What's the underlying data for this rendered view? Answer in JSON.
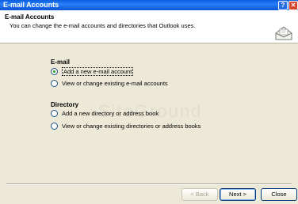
{
  "window": {
    "title": "E-mail Accounts",
    "help_label": "?",
    "close_label": "✕"
  },
  "header": {
    "title": "E-mail Accounts",
    "description": "You can change the e-mail accounts and directories that Outlook uses."
  },
  "watermark": "SiteGround",
  "email_section": {
    "title": "E-mail",
    "options": [
      {
        "label": "Add a new e-mail account",
        "selected": true
      },
      {
        "label": "View or change existing e-mail accounts",
        "selected": false
      }
    ]
  },
  "directory_section": {
    "title": "Directory",
    "options": [
      {
        "label": "Add a new directory or address book",
        "selected": false
      },
      {
        "label": "View or change existing directories or address books",
        "selected": false
      }
    ]
  },
  "buttons": {
    "back": "< Back",
    "next": "Next >",
    "close": "Close"
  },
  "colors": {
    "titlebar": "#0b55d4",
    "dialog_bg": "#ece9d8",
    "radio_dot": "#21a121"
  }
}
